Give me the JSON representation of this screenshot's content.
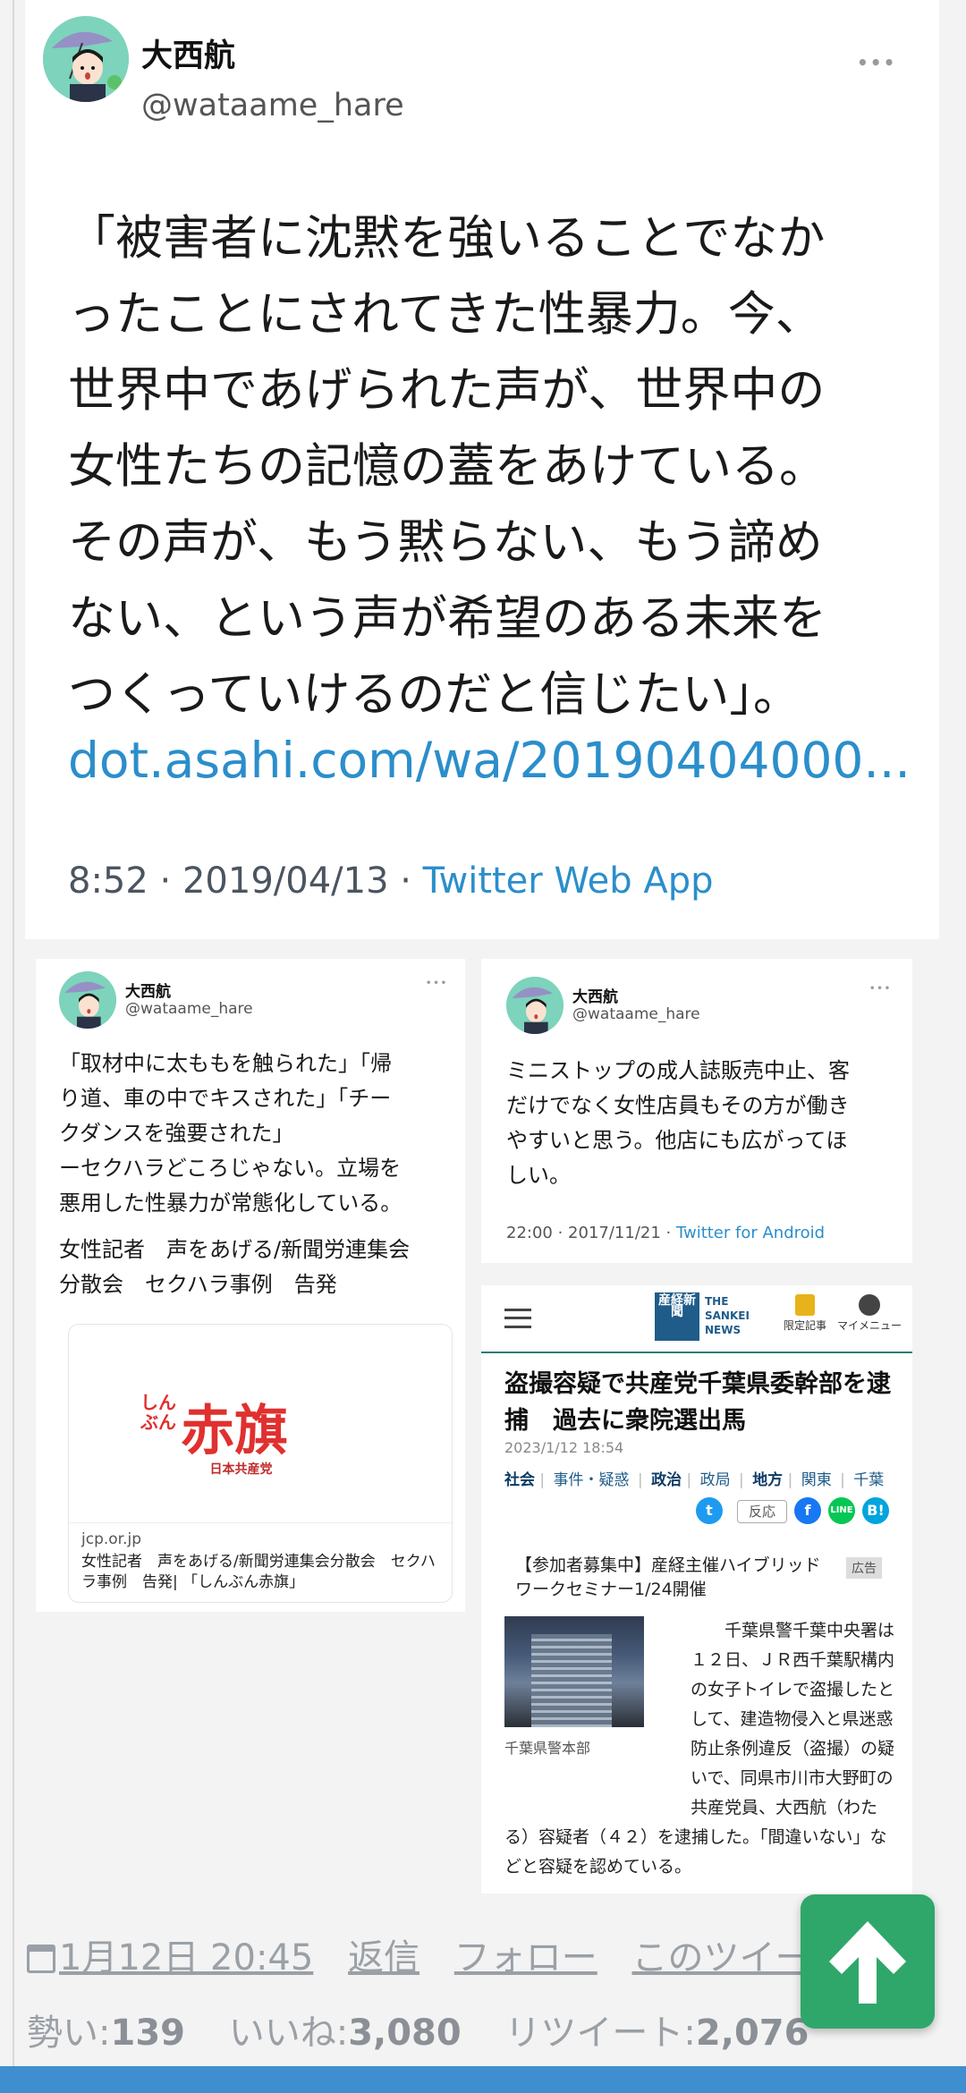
{
  "main_tweet": {
    "name": "大西航",
    "handle": "@wataame_hare",
    "more": "•••",
    "lines": [
      "「被害者に沈黙を強いることでなか",
      "ったことにされてきた性暴力。今、",
      "世界中であげられた声が、世界中の",
      "女性たちの記憶の蓋をあけている。",
      "その声が、もう黙らない、もう諦め",
      "ない、という声が希望のある未来を",
      "つくっていけるのだと信じたい」。"
    ],
    "link": "dot.asahi.com/wa/20190404000...",
    "time": "8:52 · 2019/04/13 · ",
    "via": "Twitter Web App"
  },
  "card_left": {
    "name": "大西航",
    "handle": "@wataame_hare",
    "more": "•••",
    "lines": [
      "「取材中に太ももを触られた」「帰",
      "り道、車の中でキスされた」「チー",
      "クダンスを強要された」",
      "ーセクハラどころじゃない。立場を",
      "悪用した性暴力が常態化している。"
    ],
    "lines2": [
      "女性記者　声をあげる/新聞労連集会",
      "分散会　セクハラ事例　告発"
    ],
    "link_card": {
      "logo_small": "しんぶん",
      "logo_big": "赤旗",
      "logo_sub": "日本共産党",
      "domain": "jcp.or.jp",
      "title": "女性記者　声をあげる/新聞労連集会分散会　セクハラ事例　告発| 「しんぶん赤旗」"
    }
  },
  "card_right": {
    "name": "大西航",
    "handle": "@wataame_hare",
    "more": "•••",
    "lines": [
      "ミニストップの成人誌販売中止、客",
      "だけでなく女性店員もその方が働き",
      "やすいと思う。他店にも広がってほ",
      "しい。"
    ],
    "time": "22:00 · 2017/11/21 · ",
    "via": "Twitter for Android"
  },
  "news": {
    "logo_jp": "産経新聞",
    "logo_en": [
      "THE",
      "SANKEI",
      "NEWS"
    ],
    "nav_1": "限定記事",
    "nav_2": "マイメニュー",
    "title": "盗撮容疑で共産党千葉県委幹部を逮捕　過去に衆院選出馬",
    "date": "2023/1/12 18:54",
    "categories": [
      "社会",
      "事件・疑惑",
      "政治",
      "政局",
      "地方",
      "関東",
      "千葉"
    ],
    "hanno": "反応",
    "ad": "【参加者募集中】産経主催ハイブリッドワークセミナー1/24開催",
    "ad_tag": "広告",
    "photo_caption": "千葉県警本部",
    "body": "千葉県警千葉中央署は１２日、ＪＲ西千葉駅構内の女子トイレで盗撮したとして、建造物侵入と県迷惑防止条例違反（盗撮）の疑いで、同県市川市大野町の共産党員、大西航（わたる）容疑者（４２）を逮捕した。「間違いない」などと容疑を認めている。",
    "share_colors": {
      "twitter": "#1d9bf0",
      "facebook": "#1877f2",
      "line": "#06c755",
      "hatena": "#00a4de"
    }
  },
  "footer": {
    "date": "1月12日 20:45",
    "reply": "返信",
    "follow": "フォロー",
    "this_tweet": "このツイート",
    "stat_1_label": "勢い:",
    "stat_1_value": "139",
    "stat_2_label": "いいね:",
    "stat_2_value": "3,080",
    "stat_3_label": "リツイート:",
    "stat_3_value": "2,076"
  },
  "colors": {
    "link": "#2b8ecb",
    "scroll_top_button": "#2fa76a",
    "bottom_bar": "#3f8fd0"
  }
}
